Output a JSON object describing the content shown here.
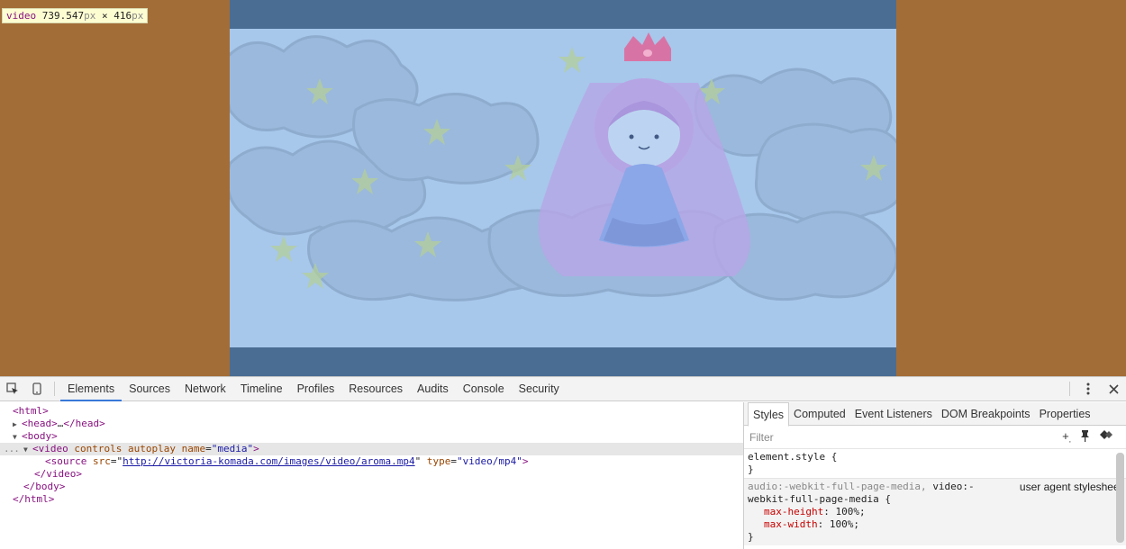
{
  "tooltip": {
    "tag": "video",
    "width": "739.547",
    "width_unit": "px",
    "times": "×",
    "height": "416",
    "height_unit": "px"
  },
  "colors": {
    "page_background": "#a36d37",
    "video_letterbox": "#4a6d93",
    "video_frame": "#a7c7eb",
    "highlight_overlay": "#a0c4ee"
  },
  "toolbar": {
    "inspect_icon": "inspect-element-icon",
    "device_icon": "device-mode-icon",
    "tabs": [
      "Elements",
      "Sources",
      "Network",
      "Timeline",
      "Profiles",
      "Resources",
      "Audits",
      "Console",
      "Security"
    ],
    "active_tab": "Elements",
    "menu_icon": "kebab-menu-icon",
    "close_icon": "close-icon"
  },
  "dom": {
    "html_open": "<html>",
    "head_open": "<head>",
    "head_ellipsis": "…",
    "head_close": "</head>",
    "body_open": "<body>",
    "video_tag_open": "<video",
    "video_attr1": "controls",
    "video_attr2": "autoplay",
    "video_attr3_name": "name",
    "video_attr3_value": "\"media\"",
    "video_tag_end": ">",
    "source_tag_open": "<source",
    "source_attr_src": "src",
    "source_src_value": "http://victoria-komada.com/images/video/aroma.mp4",
    "source_attr_type": "type",
    "source_type_value": "\"video/mp4\"",
    "source_tag_end": ">",
    "video_close": "</video>",
    "body_close": "</body>",
    "html_close": "</html>",
    "selected_dots": "..."
  },
  "styles_pane": {
    "tabs": [
      "Styles",
      "Computed",
      "Event Listeners",
      "DOM Breakpoints",
      "Properties"
    ],
    "active_tab": "Styles",
    "filter_placeholder": "Filter",
    "element_style_selector": "element.style {",
    "close_brace": "}",
    "ua_selector_gray": "audio:-webkit-full-page-media, ",
    "ua_selector_line1_rest": "video:-",
    "ua_selector_line2": "webkit-full-page-media {",
    "ua_source": "user agent stylesheet",
    "ua_props": [
      {
        "name": "max-height",
        "value": "100%;"
      },
      {
        "name": "max-width",
        "value": "100%;"
      }
    ]
  }
}
